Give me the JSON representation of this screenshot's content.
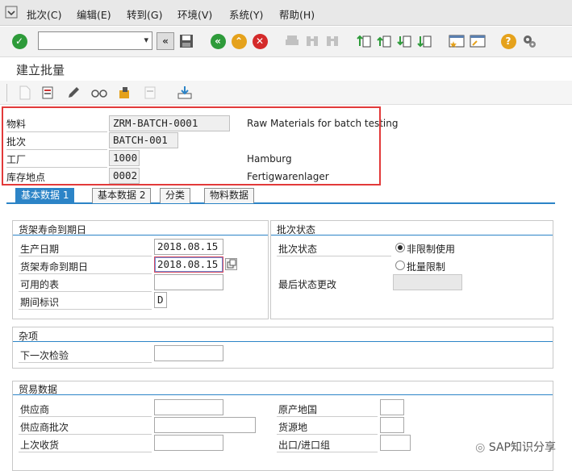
{
  "menu": [
    "批次(C)",
    "编辑(E)",
    "转到(G)",
    "环境(V)",
    "系统(Y)",
    "帮助(H)"
  ],
  "toolbar": {
    "command_value": "",
    "icons": [
      "enter-icon",
      "command-field",
      "back-icon",
      "save-icon",
      "back-green-icon",
      "exit-icon",
      "cancel-icon",
      "print-icon",
      "find-icon",
      "find-next-icon",
      "first-page-icon",
      "previous-page-icon",
      "next-page-icon",
      "last-page-icon",
      "create-session-icon",
      "shortcut-icon",
      "help-icon",
      "customize-icon"
    ]
  },
  "title": "建立批量",
  "header": {
    "material_label": "物料",
    "material_value": "ZRM-BATCH-0001",
    "material_desc": "Raw Materials for batch testing",
    "batch_label": "批次",
    "batch_value": "BATCH-001",
    "plant_label": "工厂",
    "plant_value": "1000",
    "plant_desc": "Hamburg",
    "sloc_label": "库存地点",
    "sloc_value": "0002",
    "sloc_desc": "Fertigwarenlager"
  },
  "tabs": [
    "基本数据 1",
    "基本数据 2",
    "分类",
    "物料数据"
  ],
  "shelf_life": {
    "title": "货架寿命到期日",
    "prod_date_label": "生产日期",
    "prod_date_value": "2018.08.15",
    "sled_label": "货架寿命到期日",
    "sled_value": "2018.08.15",
    "avail_label": "可用的表",
    "avail_value": "",
    "period_label": "期间标识",
    "period_value": "D"
  },
  "batch_status": {
    "title": "批次状态",
    "status_label": "批次状态",
    "option_unrestricted": "非限制使用",
    "option_restricted": "批量限制",
    "last_change_label": "最后状态更改",
    "last_change_value": ""
  },
  "misc": {
    "title": "杂项",
    "next_insp_label": "下一次检验",
    "next_insp_value": ""
  },
  "trade": {
    "title": "贸易数据",
    "vendor_label": "供应商",
    "vendor_batch_label": "供应商批次",
    "last_gr_label": "上次收货",
    "origin_country_label": "原产地国",
    "origin_region_label": "货源地",
    "import_export_label": "出口/进口组"
  },
  "watermark": "SAP知识分享",
  "colors": {
    "accent": "#2c84c7",
    "highlight_box": "#e23a3a"
  }
}
